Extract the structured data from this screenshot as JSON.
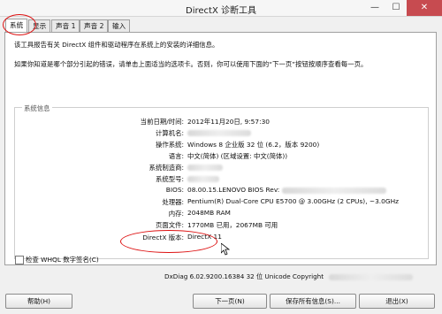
{
  "window": {
    "title": "DirectX 诊断工具",
    "minimize": "—",
    "maximize": "☐",
    "close": "✕"
  },
  "tabs": [
    {
      "label": "系统"
    },
    {
      "label": "显示"
    },
    {
      "label": "声音 1"
    },
    {
      "label": "声音 2"
    },
    {
      "label": "输入"
    }
  ],
  "intro": {
    "line1": "该工具报告有关 DirectX 组件和驱动程序在系统上的安装的详细信息。",
    "line2": "如果你知道是哪个部分引起的错误，请单击上面适当的选项卡。否则，你可以使用下面的“下一页”按钮按顺序查看每一页。"
  },
  "system_info": {
    "title": "系统信息",
    "rows": [
      {
        "label": "当前日期/时间:",
        "value": "2012年11月20日, 9:57:30"
      },
      {
        "label": "计算机名:",
        "value": ""
      },
      {
        "label": "操作系统:",
        "value": "Windows 8 企业版 32 位 (6.2，版本 9200)"
      },
      {
        "label": "语言:",
        "value": "中文(简体) (区域设置: 中文(简体))"
      },
      {
        "label": "系统制造商:",
        "value": ""
      },
      {
        "label": "系统型号:",
        "value": ""
      },
      {
        "label": "BIOS:",
        "value": "08.00.15.LENOVO BIOS Rev:"
      },
      {
        "label": "处理器:",
        "value": "Pentium(R) Dual-Core  CPU      E5700  @ 3.00GHz (2 CPUs), ~3.0GHz"
      },
      {
        "label": "内存:",
        "value": "2048MB RAM"
      },
      {
        "label": "页面文件:",
        "value": "1770MB 已用，2067MB 可用"
      },
      {
        "label": "DirectX 版本:",
        "value": "DirectX 11"
      }
    ]
  },
  "whql": {
    "label": "检查 WHQL 数字签名(C)"
  },
  "footer": {
    "text": "DxDiag 6.02.9200.16384 32 位 Unicode  Copyright"
  },
  "buttons": {
    "help": "帮助(H)",
    "next": "下一页(N)",
    "save": "保存所有信息(S)...",
    "exit": "退出(X)"
  },
  "colors": {
    "highlight_circle": "#d11111",
    "close_button": "#c74b50"
  }
}
